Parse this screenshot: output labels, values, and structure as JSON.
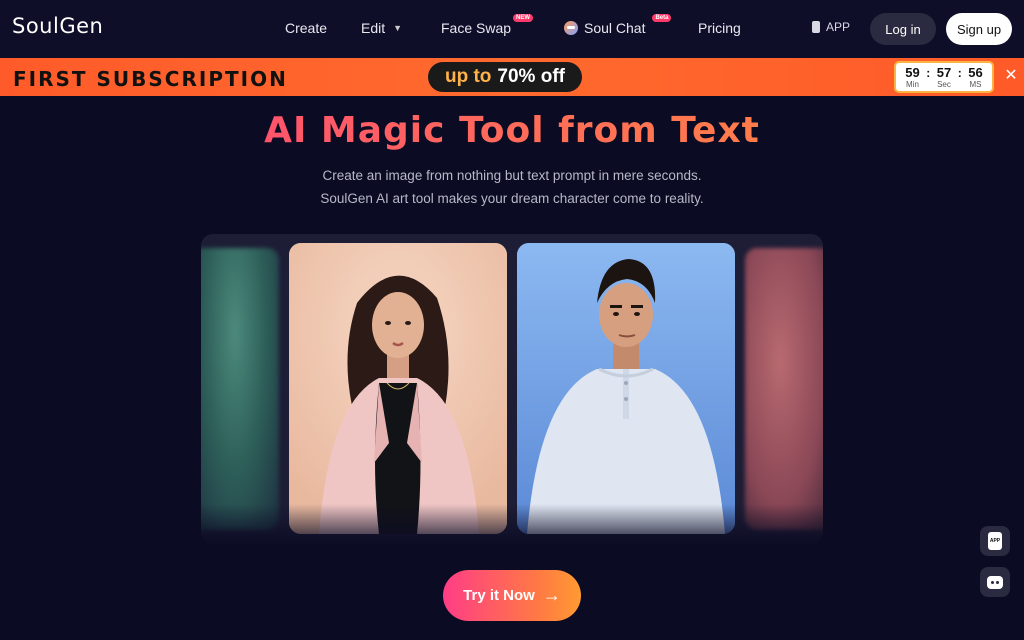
{
  "header": {
    "logo": "SoulGen",
    "nav": {
      "create": "Create",
      "edit": "Edit",
      "face_swap": "Face Swap",
      "face_swap_badge": "NEW",
      "soul_chat": "Soul Chat",
      "soul_chat_badge": "Beta",
      "pricing": "Pricing"
    },
    "app_label": "APP",
    "login_label": "Log in",
    "signup_label": "Sign up"
  },
  "promo": {
    "title": "FIRST SUBSCRIPTION",
    "up_to": "up to",
    "discount": "70% off",
    "timer": {
      "min": "59",
      "sec": "57",
      "ms": "56",
      "min_label": "Min",
      "sec_label": "Sec",
      "ms_label": "MS"
    },
    "close": "✕"
  },
  "hero": {
    "title": "AI Magic Tool from Text",
    "subtitle_line1": "Create an image from nothing but text prompt in mere seconds.",
    "subtitle_line2": "SoulGen AI art tool makes your dream character come to reality."
  },
  "cta": {
    "label": "Try it Now",
    "arrow": "→"
  },
  "floating": {
    "app_label": "APP"
  },
  "colors": {
    "background": "#0b0b24",
    "promo": "#ff6a2e",
    "accent_start": "#ff3d86",
    "accent_end": "#ff9a32"
  }
}
